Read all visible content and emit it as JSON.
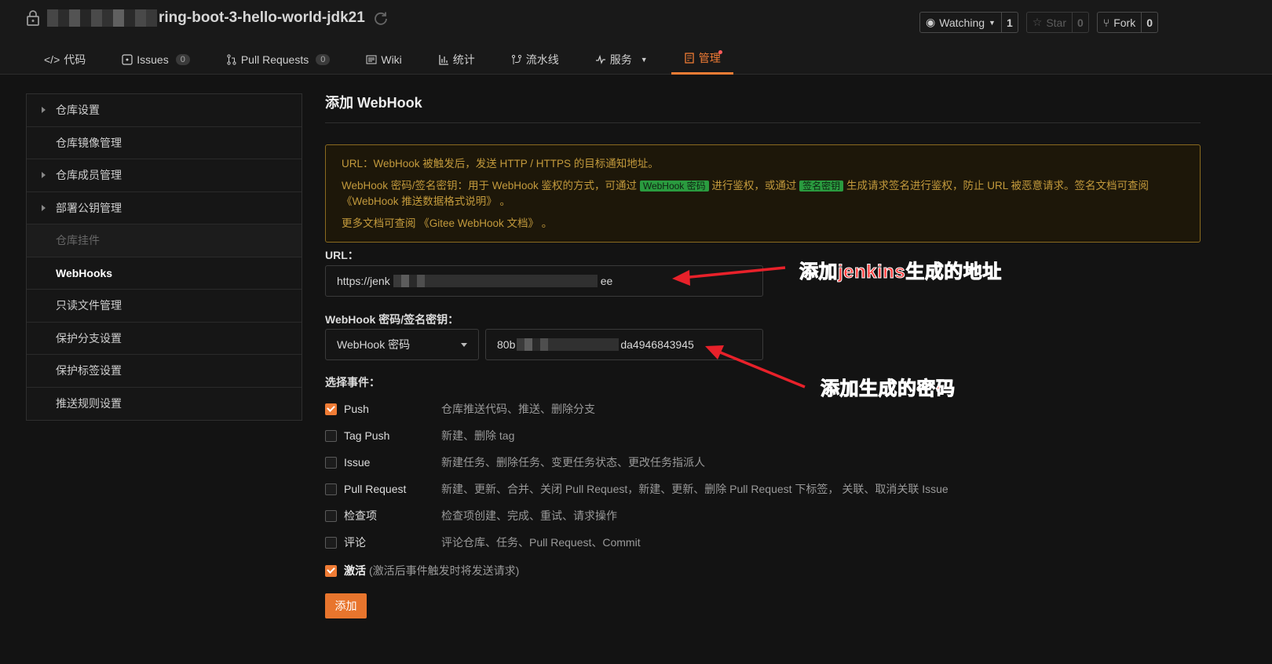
{
  "header": {
    "repo_name": "ring-boot-3-hello-world-jdk21",
    "watching_label": "Watching",
    "watching_count": "1",
    "star_label": "Star",
    "star_count": "0",
    "fork_label": "Fork",
    "fork_count": "0"
  },
  "tabs": [
    {
      "label": "代码",
      "icon": "code-icon"
    },
    {
      "label": "Issues",
      "icon": "issues-icon",
      "badge": "0"
    },
    {
      "label": "Pull Requests",
      "icon": "pull-request-icon",
      "badge": "0"
    },
    {
      "label": "Wiki",
      "icon": "wiki-icon"
    },
    {
      "label": "统计",
      "icon": "chart-icon"
    },
    {
      "label": "流水线",
      "icon": "pipeline-icon"
    },
    {
      "label": "服务",
      "icon": "pulse-icon"
    },
    {
      "label": "管理",
      "icon": "settings-doc-icon",
      "active": true
    }
  ],
  "sidebar": {
    "items": [
      {
        "label": "仓库设置",
        "caret": true
      },
      {
        "label": "仓库镜像管理"
      },
      {
        "label": "仓库成员管理",
        "caret": true
      },
      {
        "label": "部署公钥管理",
        "caret": true
      },
      {
        "label": "仓库挂件",
        "dim": true
      },
      {
        "label": "WebHooks",
        "active": true
      },
      {
        "label": "只读文件管理"
      },
      {
        "label": "保护分支设置"
      },
      {
        "label": "保护标签设置"
      },
      {
        "label": "推送规则设置"
      }
    ]
  },
  "main": {
    "title": "添加 WebHook",
    "notice": {
      "line1": "URL：WebHook 被触发后，发送 HTTP / HTTPS 的目标通知地址。",
      "line2_a": "WebHook 密码/签名密钥：用于 WebHook 鉴权的方式，可通过",
      "tag1": "WebHook 密码",
      "line2_b": "进行鉴权，或通过",
      "tag2": "签名密钥",
      "line2_c": "生成请求签名进行鉴权，防止 URL 被恶意请求。签名文档可查阅《WebHook 推送数据格式说明》 。",
      "line3": "更多文档可查阅 《Gitee WebHook 文档》 。"
    },
    "url_label": "URL：",
    "url_prefix": "https://jenk",
    "url_suffix": "ee",
    "secret_label": "WebHook 密码/签名密钥：",
    "secret_type": "WebHook 密码",
    "secret_prefix": "80b",
    "secret_suffix": "da4946843945",
    "events_label": "选择事件：",
    "events": [
      {
        "name": "Push",
        "desc": "仓库推送代码、推送、删除分支",
        "checked": true
      },
      {
        "name": "Tag Push",
        "desc": "新建、删除 tag",
        "checked": false
      },
      {
        "name": "Issue",
        "desc": "新建任务、删除任务、变更任务状态、更改任务指派人",
        "checked": false
      },
      {
        "name": "Pull Request",
        "desc": "新建、更新、合并、关闭 Pull Request，新建、更新、删除 Pull Request 下标签， 关联、取消关联 Issue",
        "checked": false
      },
      {
        "name": "检查项",
        "desc": "检查项创建、完成、重试、请求操作",
        "checked": false
      },
      {
        "name": "评论",
        "desc": "评论仓库、任务、Pull Request、Commit",
        "checked": false
      }
    ],
    "activate_label": "激活",
    "activate_hint": "(激活后事件触发时将发送请求)",
    "submit_label": "添加"
  },
  "annotations": {
    "url_note": "添加jenkins生成的地址",
    "secret_note": "添加生成的密码",
    "color": "#ff3a3a"
  },
  "colors": {
    "accent": "#f07c35",
    "background": "#131313",
    "notice_text": "#c39a3c"
  }
}
